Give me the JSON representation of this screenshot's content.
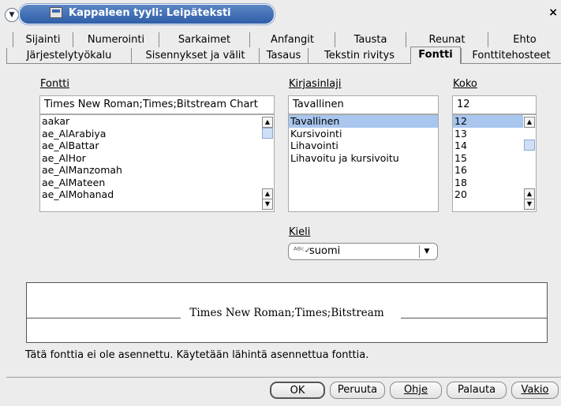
{
  "window": {
    "title": "Kappaleen tyyli: Leipäteksti"
  },
  "tabs_row1": [
    "Sijainti",
    "Numerointi",
    "Sarkaimet",
    "Anfangit",
    "Tausta",
    "Reunat",
    "Ehto"
  ],
  "tabs_row2": [
    "Järjestelytyökalu",
    "Sisennykset ja välit",
    "Tasaus",
    "Tekstin rivitys",
    "Fontti",
    "Fonttitehosteet"
  ],
  "active_tab": "Fontti",
  "font": {
    "label": "Fontti",
    "value": "Times New Roman;Times;Bitstream Chart",
    "list": [
      "aakar",
      "ae_AlArabiya",
      "ae_AlBattar",
      "ae_AlHor",
      "ae_AlManzomah",
      "ae_AlMateen",
      "ae_AlMohanad"
    ]
  },
  "style": {
    "label": "Kirjasinlaji",
    "value": "Tavallinen",
    "list": [
      "Tavallinen",
      "Kursivointi",
      "Lihavointi",
      "Lihavoitu ja kursivoitu"
    ],
    "selected": "Tavallinen"
  },
  "size": {
    "label": "Koko",
    "value": "12",
    "list": [
      "12",
      "13",
      "14",
      "15",
      "16",
      "18",
      "20"
    ],
    "selected": "12"
  },
  "language": {
    "label": "Kieli",
    "value": "suomi"
  },
  "preview": {
    "text": "Times New Roman;Times;Bitstream"
  },
  "notice": "Tätä fonttia ei ole asennettu. Käytetään lähintä asennettua fonttia.",
  "buttons": {
    "ok": "OK",
    "cancel": "Peruuta",
    "help": "Ohje",
    "reset": "Palauta",
    "standard": "Vakio"
  },
  "colors": {
    "selection": "#a8c6ee",
    "title_bar": "#3d6db5"
  }
}
